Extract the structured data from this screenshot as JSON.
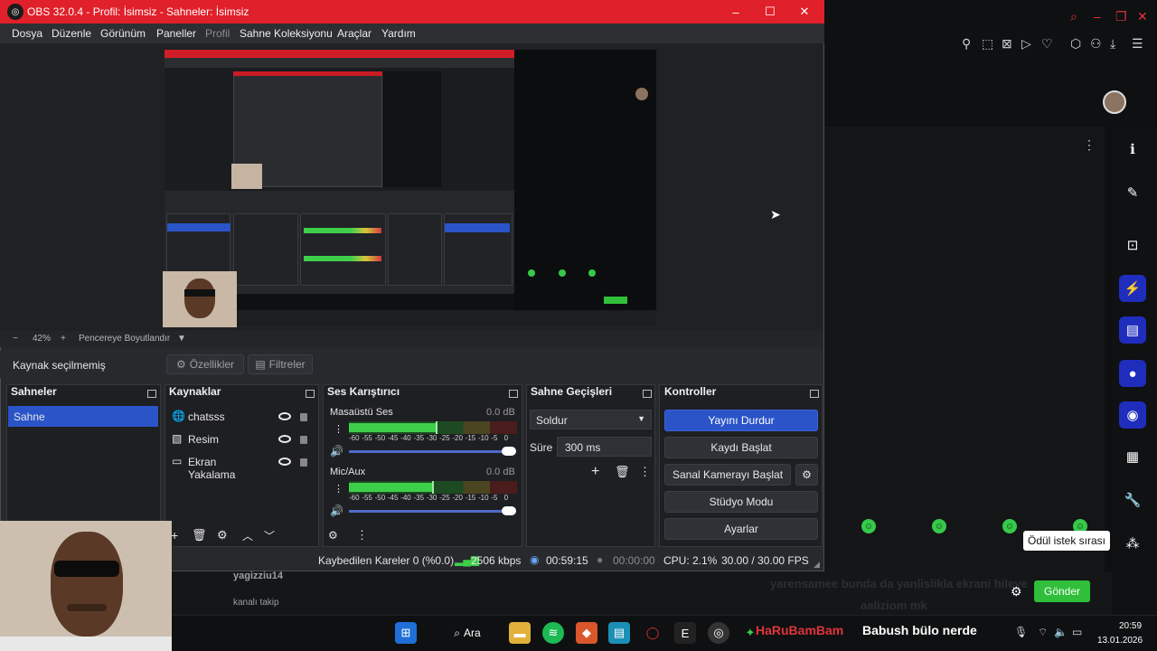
{
  "obs": {
    "title": "OBS 32.0.4 - Profil: İsimsiz - Sahneler: İsimsiz",
    "menu": [
      "Dosya",
      "Düzenle",
      "Görünüm",
      "Paneller",
      "Profil",
      "Sahne Koleksiyonu",
      "Araçlar",
      "Yardım"
    ],
    "zoom": "42%",
    "zoom_fit": "Pencereye Boyutlandır",
    "no_source": "Kaynak seçilmemiş",
    "properties": "Özellikler",
    "filters": "Filtreler",
    "docks": {
      "scenes": {
        "title": "Sahneler",
        "items": [
          "Sahne"
        ]
      },
      "sources": {
        "title": "Kaynaklar",
        "items": [
          "chatsss",
          "Resim",
          "Ekran Yakalama"
        ]
      },
      "mixer": {
        "title": "Ses Karıştırıcı",
        "channels": [
          {
            "name": "Masaüstü Ses",
            "db": "0.0 dB"
          },
          {
            "name": "Mic/Aux",
            "db": "0.0 dB"
          }
        ],
        "scale": [
          "-60",
          "-55",
          "-50",
          "-45",
          "-40",
          "-35",
          "-30",
          "-25",
          "-20",
          "-15",
          "-10",
          "-5",
          "0"
        ]
      },
      "transitions": {
        "title": "Sahne Geçişleri",
        "type": "Soldur",
        "duration_label": "Süre",
        "duration": "300 ms"
      },
      "controls": {
        "title": "Kontroller",
        "buttons": [
          "Yayını Durdur",
          "Kaydı Başlat",
          "Sanal Kamerayı Başlat",
          "Stüdyo Modu",
          "Ayarlar"
        ]
      }
    },
    "status": {
      "dropped": "Kaybedilen Kareler 0 (%0.0)",
      "bitrate": "2506 kbps",
      "live_time": "00:59:15",
      "rec_time": "00:00:00",
      "cpu": "CPU: 2.1%",
      "fps": "30.00 / 30.00 FPS"
    }
  },
  "background": {
    "tooltip": "Ödül istek sırası",
    "send_button": "Gönder",
    "chat_user": "yagizziu14",
    "chat_follow": "kanalı takip",
    "chat_msg": "yarensamee  bunda da yanlislikla ekrani hileye",
    "chat_msg2": "aaliziom mk"
  },
  "taskbar": {
    "search": "Ara",
    "ticker_user": "HaRuBamBam",
    "ticker_text": "Babush bülo nerde",
    "time": "20:59",
    "date": "13.01.2026"
  },
  "colors": {
    "obs_title_red": "#e0202a",
    "accent_blue": "#2a54c8",
    "meter_green": "#3ecf4a",
    "meter_yellow": "#d6c63a",
    "meter_red": "#d13b3b",
    "emote_green": "#36c94a",
    "send_green": "#2fbf3a"
  }
}
